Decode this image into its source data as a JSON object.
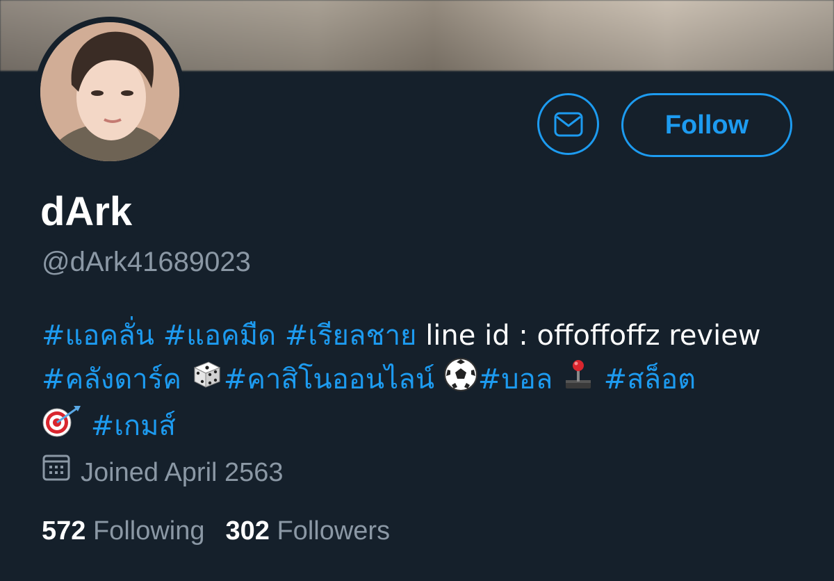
{
  "profile": {
    "display_name": "dArk",
    "handle": "@dArk41689023",
    "follow_label": "Follow",
    "joined": "Joined April 2563",
    "bio": {
      "tag1": "#แอคลั่น",
      "tag2": "#แอคมืด",
      "tag3": "#เรียลชาย",
      "text1": "line id : offoffoffz review",
      "tag4": "#คลังดาร์ค",
      "tag5": "#คาสิโนออนไลน์",
      "tag6": "#บอล",
      "tag7": "#สล็อต",
      "tag8": "#เกมส์"
    },
    "stats": {
      "following_count": "572",
      "following_label": "Following",
      "followers_count": "302",
      "followers_label": "Followers"
    }
  },
  "colors": {
    "background": "#15202b",
    "accent": "#1d9bf0",
    "secondary_text": "#8b98a5"
  },
  "icons": {
    "message": "envelope-icon",
    "calendar": "calendar-icon",
    "emoji_dice": "dice-icon",
    "emoji_soccer": "soccer-ball-icon",
    "emoji_joystick": "joystick-icon",
    "emoji_target": "target-icon"
  }
}
